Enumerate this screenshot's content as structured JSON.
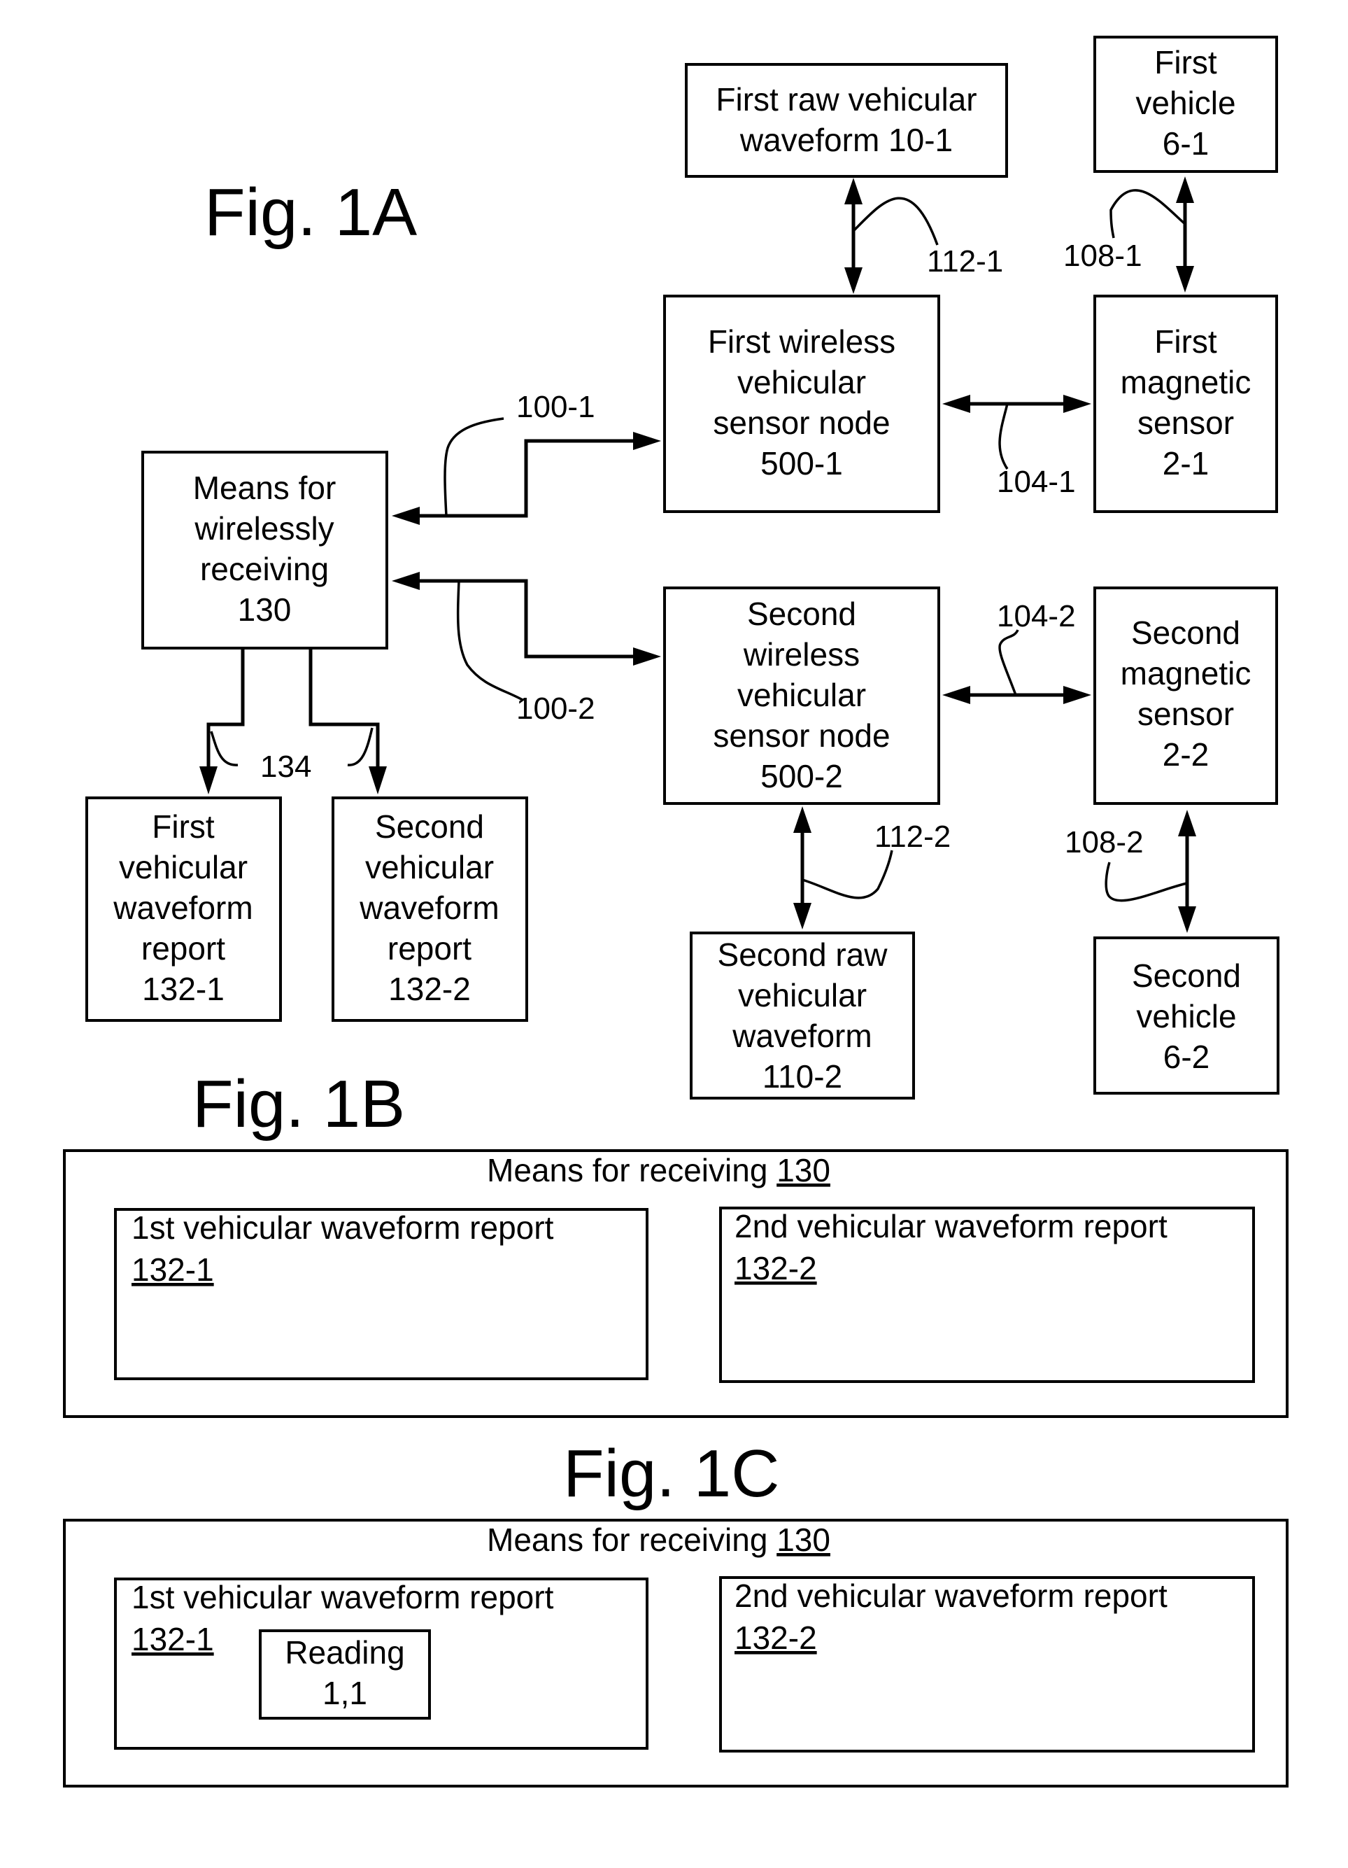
{
  "fig1a": {
    "title": "Fig. 1A",
    "boxes": {
      "raw1": [
        "First raw vehicular",
        "waveform 10-1"
      ],
      "vehicle1": [
        "First",
        "vehicle",
        "6-1"
      ],
      "node1": [
        "First wireless",
        "vehicular",
        "sensor node",
        "500-1"
      ],
      "magsensor1": [
        "First",
        "magnetic",
        "sensor",
        "2-1"
      ],
      "receiver": [
        "Means for",
        "wirelessly",
        "receiving",
        "130"
      ],
      "node2": [
        "Second",
        "wireless",
        "vehicular",
        "sensor node",
        "500-2"
      ],
      "magsensor2": [
        "Second",
        "magnetic",
        "sensor",
        "2-2"
      ],
      "report1": [
        "First",
        "vehicular",
        "waveform",
        "report",
        "132-1"
      ],
      "report2": [
        "Second",
        "vehicular",
        "waveform",
        "report",
        "132-2"
      ],
      "raw2": [
        "Second raw",
        "vehicular",
        "waveform",
        "110-2"
      ],
      "vehicle2": [
        "Second",
        "vehicle",
        "6-2"
      ]
    },
    "labels": {
      "l112_1": "112-1",
      "l108_1": "108-1",
      "l100_1": "100-1",
      "l104_1": "104-1",
      "l100_2": "100-2",
      "l104_2": "104-2",
      "l134": "134",
      "l112_2": "112-2",
      "l108_2": "108-2"
    }
  },
  "fig1b": {
    "title": "Fig. 1B",
    "container_label": "Means for receiving ",
    "container_ref": "130",
    "report1_label": "1st vehicular waveform report",
    "report1_ref": "132-1",
    "report2_label": "2nd vehicular waveform report",
    "report2_ref": "132-2"
  },
  "fig1c": {
    "title": "Fig. 1C",
    "container_label": "Means for receiving ",
    "container_ref": "130",
    "report1_label": "1st vehicular waveform report",
    "report1_ref": "132-1",
    "reading_label": [
      "Reading",
      "1,1"
    ],
    "report2_label": "2nd vehicular waveform report",
    "report2_ref": "132-2"
  }
}
